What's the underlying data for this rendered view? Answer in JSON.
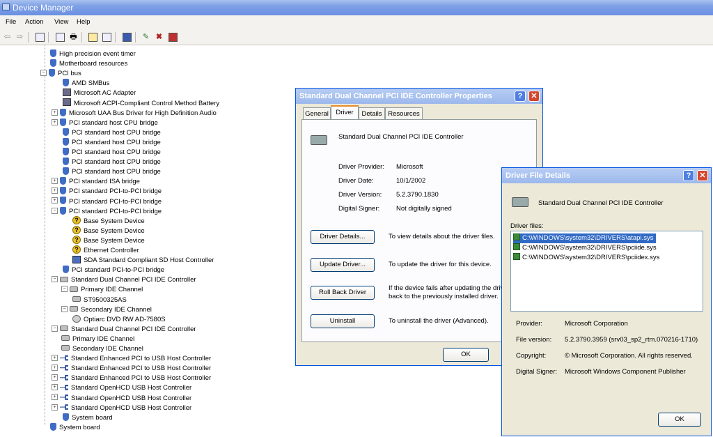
{
  "app": {
    "title": "Device Manager"
  },
  "menu": [
    "File",
    "Action",
    "View",
    "Help"
  ],
  "tree": [
    {
      "label": "High precision event timer",
      "icon": "device-icon"
    },
    {
      "label": "Motherboard resources",
      "icon": "device-icon"
    },
    {
      "label": "PCI bus",
      "icon": "device-icon",
      "expander": "−"
    },
    {
      "label": "AMD SMBus",
      "icon": "device-icon"
    },
    {
      "label": "Microsoft AC Adapter",
      "icon": "battery-icon"
    },
    {
      "label": "Microsoft ACPI-Compliant Control Method Battery",
      "icon": "battery-icon"
    },
    {
      "label": "Microsoft UAA Bus Driver for High Definition Audio",
      "icon": "device-icon",
      "expander": "+"
    },
    {
      "label": "PCI standard host CPU bridge",
      "icon": "device-icon",
      "expander": "+"
    },
    {
      "label": "PCI standard host CPU bridge",
      "icon": "device-icon"
    },
    {
      "label": "PCI standard host CPU bridge",
      "icon": "device-icon"
    },
    {
      "label": "PCI standard host CPU bridge",
      "icon": "device-icon"
    },
    {
      "label": "PCI standard host CPU bridge",
      "icon": "device-icon"
    },
    {
      "label": "PCI standard host CPU bridge",
      "icon": "device-icon"
    },
    {
      "label": "PCI standard ISA bridge",
      "icon": "device-icon",
      "expander": "+"
    },
    {
      "label": "PCI standard PCI-to-PCI bridge",
      "icon": "device-icon",
      "expander": "+"
    },
    {
      "label": "PCI standard PCI-to-PCI bridge",
      "icon": "device-icon",
      "expander": "+"
    },
    {
      "label": "PCI standard PCI-to-PCI bridge",
      "icon": "device-icon",
      "expander": "−"
    },
    {
      "label": "Base System Device",
      "icon": "warning-icon"
    },
    {
      "label": "Base System Device",
      "icon": "warning-icon"
    },
    {
      "label": "Base System Device",
      "icon": "warning-icon"
    },
    {
      "label": "Ethernet Controller",
      "icon": "warning-icon"
    },
    {
      "label": "SDA Standard Compliant SD Host Controller",
      "icon": "sd-host-icon"
    },
    {
      "label": "PCI standard PCI-to-PCI bridge",
      "icon": "device-icon"
    },
    {
      "label": "Standard Dual Channel PCI IDE Controller",
      "icon": "ide-controller-icon",
      "expander": "−"
    },
    {
      "label": "Primary IDE Channel",
      "icon": "ide-channel-icon",
      "expander": "−"
    },
    {
      "label": "ST9500325AS",
      "icon": "hard-disk-icon"
    },
    {
      "label": "Secondary IDE Channel",
      "icon": "ide-channel-icon",
      "expander": "−"
    },
    {
      "label": "Optiarc DVD RW AD-7580S",
      "icon": "dvd-drive-icon"
    },
    {
      "label": "Standard Dual Channel PCI IDE Controller",
      "icon": "ide-controller-icon",
      "expander": "−"
    },
    {
      "label": "Primary IDE Channel",
      "icon": "ide-channel-icon"
    },
    {
      "label": "Secondary IDE Channel",
      "icon": "ide-channel-icon"
    },
    {
      "label": "Standard Enhanced PCI to USB Host Controller",
      "icon": "usb-icon",
      "expander": "+"
    },
    {
      "label": "Standard Enhanced PCI to USB Host Controller",
      "icon": "usb-icon",
      "expander": "+"
    },
    {
      "label": "Standard Enhanced PCI to USB Host Controller",
      "icon": "usb-icon",
      "expander": "+"
    },
    {
      "label": "Standard OpenHCD USB Host Controller",
      "icon": "usb-icon",
      "expander": "+"
    },
    {
      "label": "Standard OpenHCD USB Host Controller",
      "icon": "usb-icon",
      "expander": "+"
    },
    {
      "label": "Standard OpenHCD USB Host Controller",
      "icon": "usb-icon",
      "expander": "+"
    },
    {
      "label": "System board",
      "icon": "device-icon"
    },
    {
      "label": "System board",
      "icon": "device-icon"
    }
  ],
  "props": {
    "title": "Standard Dual Channel PCI IDE Controller Properties",
    "tabs": [
      "General",
      "Driver",
      "Details",
      "Resources"
    ],
    "device_name": "Standard Dual Channel PCI IDE Controller",
    "provider_label": "Driver Provider:",
    "provider": "Microsoft",
    "date_label": "Driver Date:",
    "date": "10/1/2002",
    "version_label": "Driver Version:",
    "version": "5.2.3790.1830",
    "signer_label": "Digital Signer:",
    "signer": "Not digitally signed",
    "details_btn": "Driver Details...",
    "details_desc": "To view details about the driver files.",
    "update_btn": "Update Driver...",
    "update_desc": "To update the driver for this device.",
    "rollback_btn": "Roll Back Driver",
    "rollback_desc": "If the device fails after updating the driv back to the previously installed driver.",
    "uninstall_btn": "Uninstall",
    "uninstall_desc": "To uninstall the driver (Advanced).",
    "ok": "OK"
  },
  "dfd": {
    "title": "Driver File Details",
    "device_name": "Standard Dual Channel PCI IDE Controller",
    "files_label": "Driver files:",
    "files": [
      "C:\\WINDOWS\\system32\\DRIVERS\\atapi.sys",
      "C:\\WINDOWS\\system32\\DRIVERS\\pciide.sys",
      "C:\\WINDOWS\\system32\\DRIVERS\\pciidex.sys"
    ],
    "provider_label": "Provider:",
    "provider": "Microsoft Corporation",
    "fver_label": "File version:",
    "fver": "5.2.3790.3959 (srv03_sp2_rtm.070216-1710)",
    "copyright_label": "Copyright:",
    "copyright": "© Microsoft Corporation. All rights reserved.",
    "signer_label": "Digital Signer:",
    "signer": "Microsoft Windows Component Publisher",
    "ok": "OK"
  }
}
